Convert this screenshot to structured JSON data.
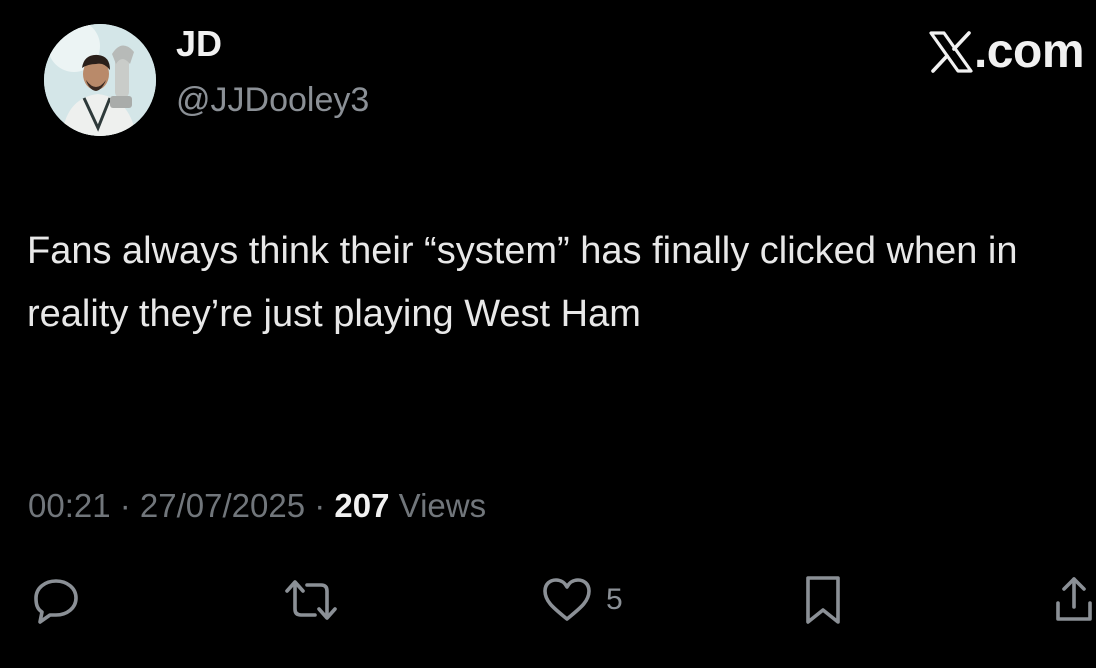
{
  "author": {
    "display_name": "JD",
    "handle": "@JJDooley3",
    "avatar_icon": "avatar-photo"
  },
  "brand": {
    "text": ".com",
    "icon": "x-logo-icon"
  },
  "tweet": {
    "text": "Fans always think their “system” has finally clicked when in reality they’re just playing West Ham"
  },
  "meta": {
    "time": "00:21",
    "separator": " · ",
    "date": "27/07/2025",
    "views_count": "207",
    "views_label": " Views"
  },
  "actions": {
    "reply_icon": "reply-icon",
    "retweet_icon": "retweet-icon",
    "like_icon": "heart-icon",
    "like_count": "5",
    "bookmark_icon": "bookmark-icon",
    "share_icon": "share-icon"
  },
  "colors": {
    "background": "#000000",
    "primary_text": "#e7e9ea",
    "secondary_text": "#71767b"
  }
}
